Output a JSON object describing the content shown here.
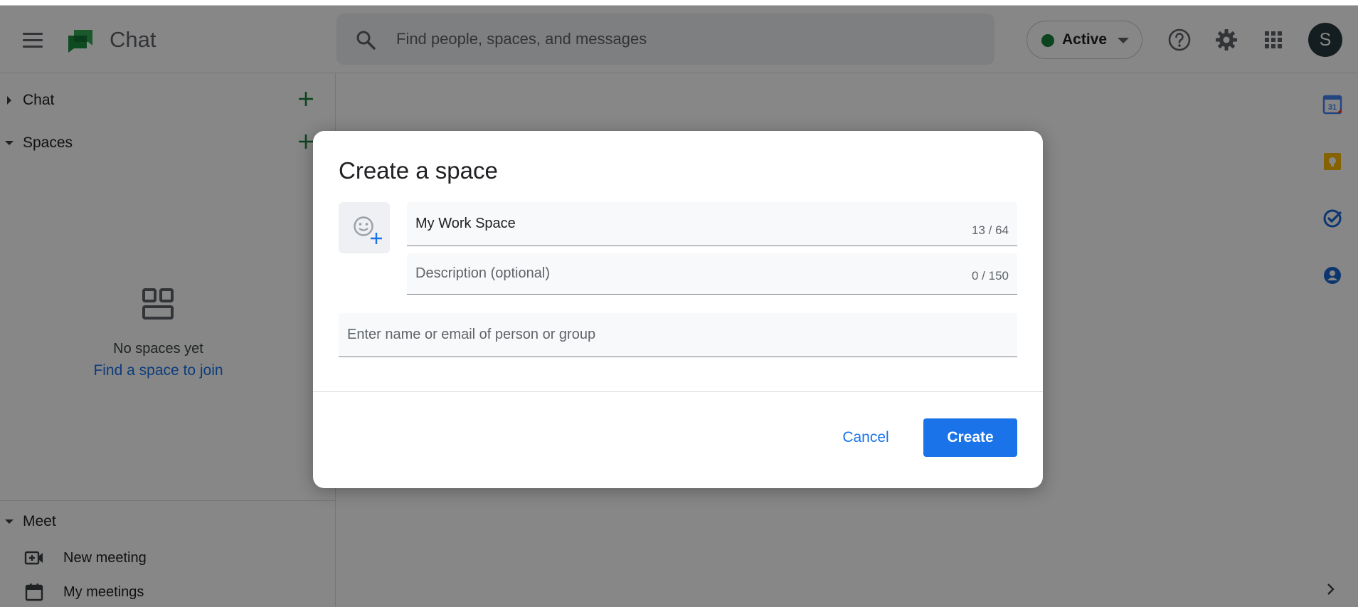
{
  "header": {
    "app_name": "Chat",
    "search_placeholder": "Find people, spaces, and messages",
    "status": "Active",
    "avatar_initial": "S"
  },
  "sidebar": {
    "sections": {
      "chat": "Chat",
      "spaces": "Spaces",
      "meet": "Meet"
    },
    "empty_state": {
      "message": "No spaces yet",
      "link": "Find a space to join"
    },
    "meet_items": [
      "New meeting",
      "My meetings"
    ]
  },
  "rail": {
    "calendar_day": "31"
  },
  "dialog": {
    "title": "Create a space",
    "name_value": "My Work Space",
    "name_counter": "13 / 64",
    "description_placeholder": "Description (optional)",
    "description_counter": "0 / 150",
    "people_placeholder": "Enter name or email of person or group",
    "cancel_label": "Cancel",
    "create_label": "Create"
  },
  "colors": {
    "brand_green": "#188038",
    "accent_blue": "#1a73e8"
  },
  "icons": [
    "menu-icon",
    "chat-logo-icon",
    "search-icon",
    "help-icon",
    "settings-icon",
    "apps-grid-icon",
    "plus-icon",
    "spaces-empty-icon",
    "video-add-icon",
    "calendar-icon",
    "calendar-app-icon",
    "keep-icon",
    "tasks-icon",
    "contacts-icon",
    "chevron-right-icon",
    "emoji-add-icon"
  ]
}
